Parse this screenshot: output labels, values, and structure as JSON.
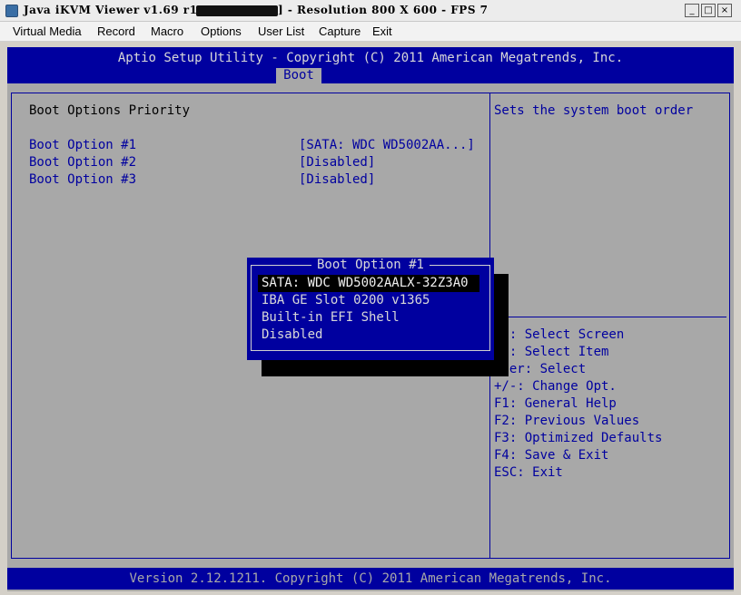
{
  "window": {
    "title": "Java iKVM Viewer v1.69 r1",
    "title_suffix": "] - Resolution 800 X 600 - FPS 7",
    "minimize_icon": "_",
    "maximize_icon": "□",
    "close_icon": "×"
  },
  "menubar": {
    "items": [
      "Virtual Media",
      "Record",
      "Macro",
      "Options",
      "User List",
      "Capture",
      "Exit"
    ]
  },
  "bios": {
    "header_title": "Aptio Setup Utility - Copyright (C) 2011 American Megatrends, Inc.",
    "active_tab": "Boot",
    "section_heading": "Boot Options Priority",
    "options": [
      {
        "label": "Boot Option #1",
        "value": "[SATA: WDC WD5002AA...]"
      },
      {
        "label": "Boot Option #2",
        "value": "[Disabled]"
      },
      {
        "label": "Boot Option #3",
        "value": "[Disabled]"
      }
    ],
    "help_text": "Sets the system boot order",
    "key_help": [
      "  : Select Screen",
      "  : Select Item",
      " ter: Select",
      "+/-: Change Opt.",
      "F1: General Help",
      "F2: Previous Values",
      "F3: Optimized Defaults",
      "F4: Save & Exit",
      "ESC: Exit"
    ],
    "popup": {
      "title": "Boot Option #1",
      "items": [
        "SATA: WDC WD5002AALX-32Z3A0",
        "IBA GE Slot 0200 v1365",
        "Built-in EFI Shell",
        "Disabled"
      ],
      "selected_index": 0
    },
    "footer": "Version 2.12.1211. Copyright (C) 2011 American Megatrends, Inc.",
    "colors": {
      "background": "#a8a8a8",
      "accent_blue": "#00009f",
      "text_light": "#d8d8d8"
    }
  }
}
